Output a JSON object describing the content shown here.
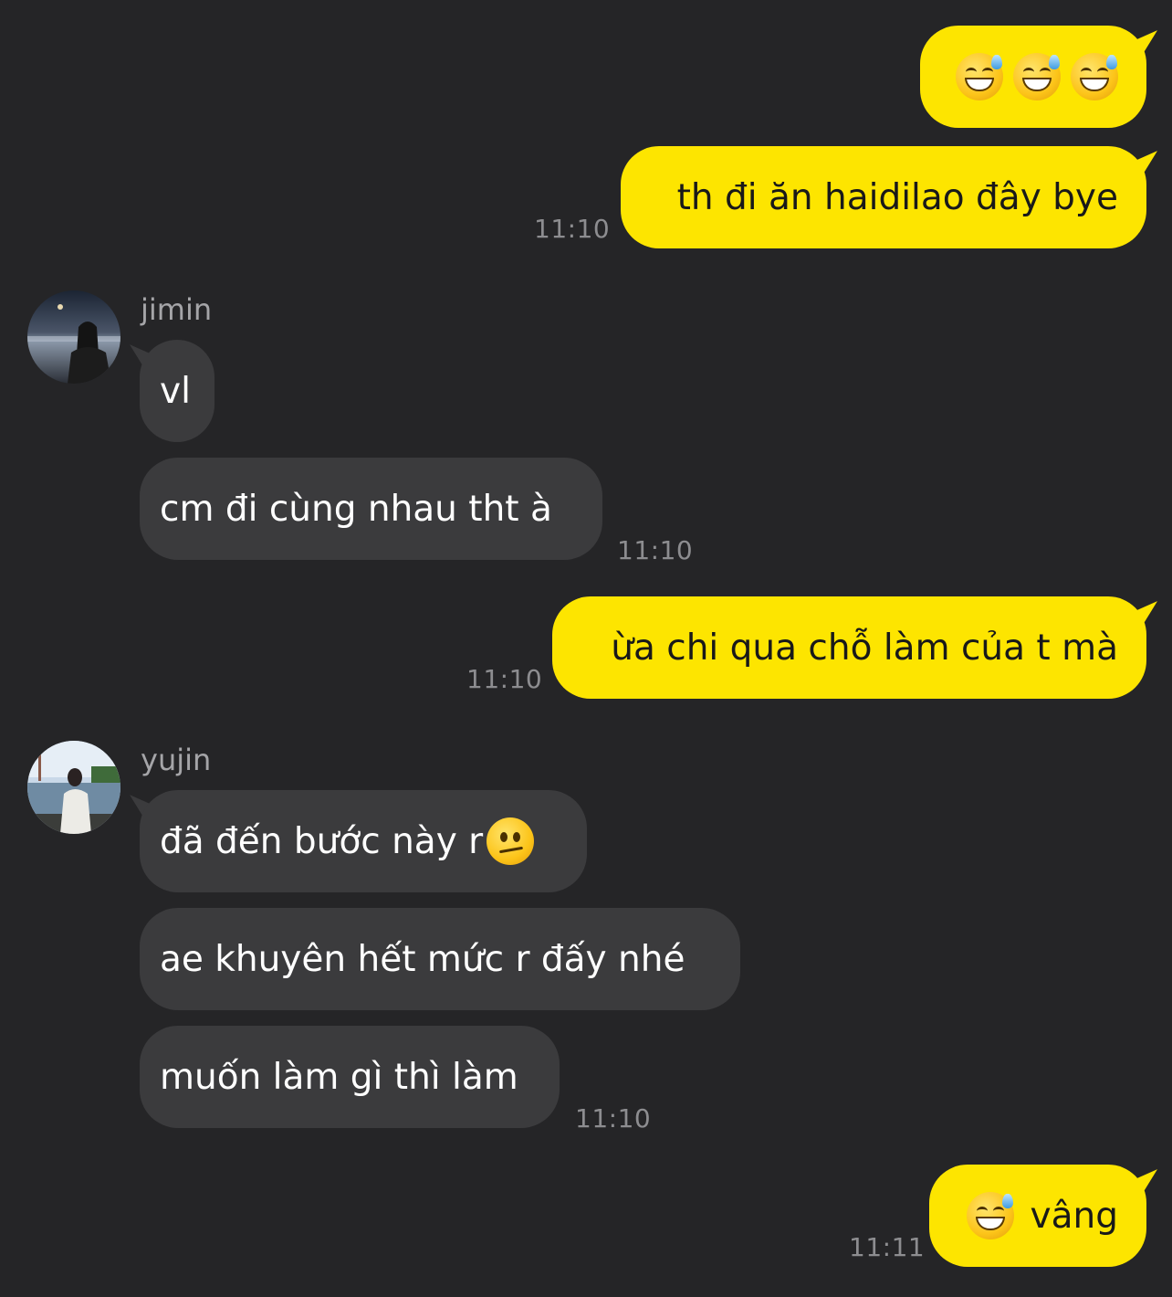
{
  "messages": [
    {
      "id": "m1",
      "text": "",
      "time": ""
    },
    {
      "id": "m2",
      "text": "th đi ăn haidilao đây bye",
      "time": "11:10"
    },
    {
      "id": "m3",
      "sender": "jimin",
      "text": "vl"
    },
    {
      "id": "m4",
      "sender": "jimin",
      "text": "cm đi cùng nhau tht à",
      "time": "11:10"
    },
    {
      "id": "m5",
      "text": "ừa chi qua chỗ làm của t mà",
      "time": "11:10"
    },
    {
      "id": "m6",
      "sender": "yujin",
      "text": "đã đến bước này r"
    },
    {
      "id": "m7",
      "sender": "yujin",
      "text": "ae khuyên hết mức r đấy nhé"
    },
    {
      "id": "m8",
      "sender": "yujin",
      "text": "muốn làm gì thì làm",
      "time": "11:10"
    },
    {
      "id": "m9",
      "text": "vâng",
      "time": "11:11"
    }
  ],
  "icons": {
    "sweat": "grinning-sweat-emoji-icon",
    "confused": "confused-face-emoji-icon"
  },
  "colors": {
    "background": "#252527",
    "outgoing_bubble": "#fde500",
    "incoming_bubble": "#3b3b3d",
    "time_text": "#8d8d90"
  }
}
